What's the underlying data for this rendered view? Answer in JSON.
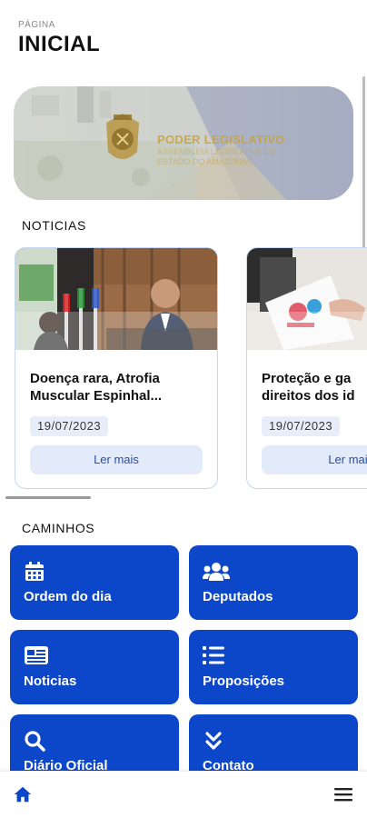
{
  "header": {
    "kicker": "PÁGINA",
    "title": "INICIAL"
  },
  "banner": {
    "title": "PODER LEGISLATIVO",
    "subtitle_lines": [
      "ASSEMBLEIA LEGISLATIVA DO",
      "ESTADO DO AMAZONAS"
    ]
  },
  "news": {
    "section_title": "NOTICIAS",
    "cards": [
      {
        "title": "Doença rara, Atrofia\nMuscular Espinhal...",
        "date": "19/07/2023",
        "button": "Ler mais"
      },
      {
        "title": "Proteção e ga\ndireitos dos id",
        "date": "19/07/2023",
        "button": "Ler mai"
      }
    ]
  },
  "paths": {
    "section_title": "CAMINHOS",
    "tiles": [
      {
        "label": "Ordem do dia",
        "icon": "calendar-icon"
      },
      {
        "label": "Deputados",
        "icon": "users-icon"
      },
      {
        "label": "Noticias",
        "icon": "newspaper-icon"
      },
      {
        "label": "Proposições",
        "icon": "list-icon"
      },
      {
        "label": "Diário Oficial",
        "icon": "search-icon"
      },
      {
        "label": "Contato",
        "icon": "double-chevron-down-icon"
      }
    ]
  },
  "nav": {
    "home_icon": "home-icon",
    "menu_icon": "menu-icon"
  },
  "colors": {
    "primary": "#0d47c9",
    "accent_gold": "#c9a23b",
    "card_border": "#c8d5f0"
  }
}
